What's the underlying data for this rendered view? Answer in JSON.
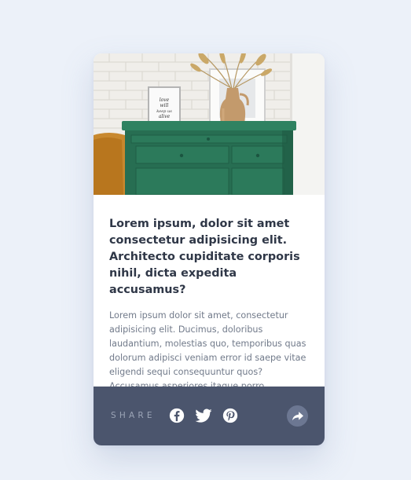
{
  "card": {
    "title": "Lorem ipsum, dolor sit amet consectetur adipisicing elit. Architecto cupiditate corporis nihil, dicta expedita accusamus?",
    "description": "Lorem ipsum dolor sit amet, consectetur adipisicing elit. Ducimus, doloribus laudantium, molestias quo, temporibus quas dolorum adipisci veniam error id saepe vitae eligendi sequi consequuntur quos? Accusamus asperiores itaque porro.",
    "image": {
      "frame_text": [
        "love",
        "will",
        "keep us",
        "alive"
      ]
    }
  },
  "footer": {
    "share_label": "SHARE",
    "icons": [
      "facebook-icon",
      "twitter-icon",
      "pinterest-icon",
      "share-arrow-icon"
    ]
  },
  "colors": {
    "background": "#ecf1f9",
    "footer": "#4b556d",
    "share_label": "#9ba4b6",
    "forward_button": "#6c7792",
    "title": "#2f3747",
    "description": "#717a8a",
    "dresser_green": "#2d7a5c"
  }
}
